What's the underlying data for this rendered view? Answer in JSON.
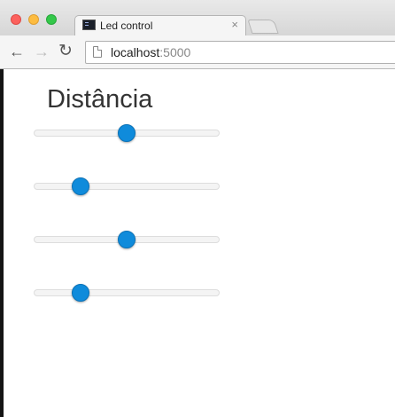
{
  "browser": {
    "tab": {
      "title": "Led control",
      "close_glyph": "×",
      "icon": "terminal-icon"
    },
    "url": {
      "host": "localhost",
      "port": ":5000"
    },
    "nav": {
      "back_glyph": "←",
      "forward_glyph": "→",
      "reload_glyph": "↻"
    }
  },
  "page": {
    "heading": "Distância",
    "sliders": [
      {
        "value_percent": 50
      },
      {
        "value_percent": 25
      },
      {
        "value_percent": 50
      },
      {
        "value_percent": 25
      }
    ]
  },
  "colors": {
    "slider_thumb": "#0f8bdb",
    "traffic_close": "#fc615d",
    "traffic_minimize": "#fdbc40",
    "traffic_maximize": "#34c84a"
  }
}
